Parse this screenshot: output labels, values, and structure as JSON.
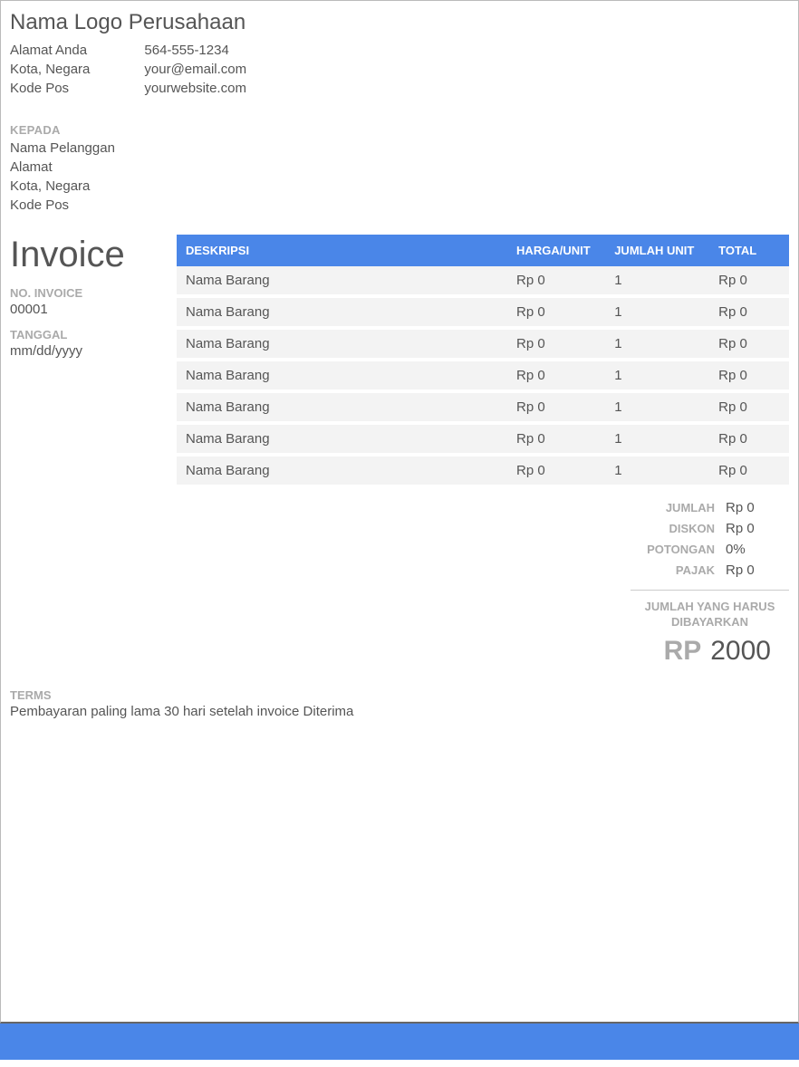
{
  "company": {
    "name": "Nama Logo Perusahaan",
    "address": "Alamat Anda",
    "city": "Kota, Negara",
    "postal": "Kode Pos",
    "phone": "564-555-1234",
    "email": "your@email.com",
    "website": "yourwebsite.com"
  },
  "labels": {
    "to": "KEPADA",
    "invoice_title": "Invoice",
    "invoice_no": "NO. INVOICE",
    "date": "TANGGAL",
    "col_desc": "DESKRIPSI",
    "col_price": "HARGA/UNIT",
    "col_qty": "JUMLAH UNIT",
    "col_total": "TOTAL",
    "subtotal": "JUMLAH",
    "discount": "DISKON",
    "deduction": "POTONGAN",
    "tax": "PAJAK",
    "balance_due": "JUMLAH YANG HARUS DIBAYARKAN",
    "currency": "RP",
    "terms": "TERMS"
  },
  "customer": {
    "name": "Nama Pelanggan",
    "address": "Alamat",
    "city": "Kota, Negara",
    "postal": "Kode Pos"
  },
  "invoice": {
    "number": "00001",
    "date": "mm/dd/yyyy"
  },
  "items": [
    {
      "desc": "Nama Barang",
      "price": "Rp 0",
      "qty": "1",
      "total": "Rp 0"
    },
    {
      "desc": "Nama Barang",
      "price": "Rp 0",
      "qty": "1",
      "total": "Rp 0"
    },
    {
      "desc": "Nama Barang",
      "price": "Rp 0",
      "qty": "1",
      "total": "Rp 0"
    },
    {
      "desc": "Nama Barang",
      "price": "Rp 0",
      "qty": "1",
      "total": "Rp 0"
    },
    {
      "desc": "Nama Barang",
      "price": "Rp 0",
      "qty": "1",
      "total": "Rp 0"
    },
    {
      "desc": "Nama Barang",
      "price": "Rp 0",
      "qty": "1",
      "total": "Rp 0"
    },
    {
      "desc": "Nama Barang",
      "price": "Rp 0",
      "qty": "1",
      "total": "Rp 0"
    }
  ],
  "summary": {
    "subtotal": "Rp 0",
    "discount": "Rp 0",
    "deduction": "0%",
    "tax": "Rp 0",
    "balance_due": "2000"
  },
  "terms_text": "Pembayaran paling lama 30 hari setelah invoice Diterima"
}
